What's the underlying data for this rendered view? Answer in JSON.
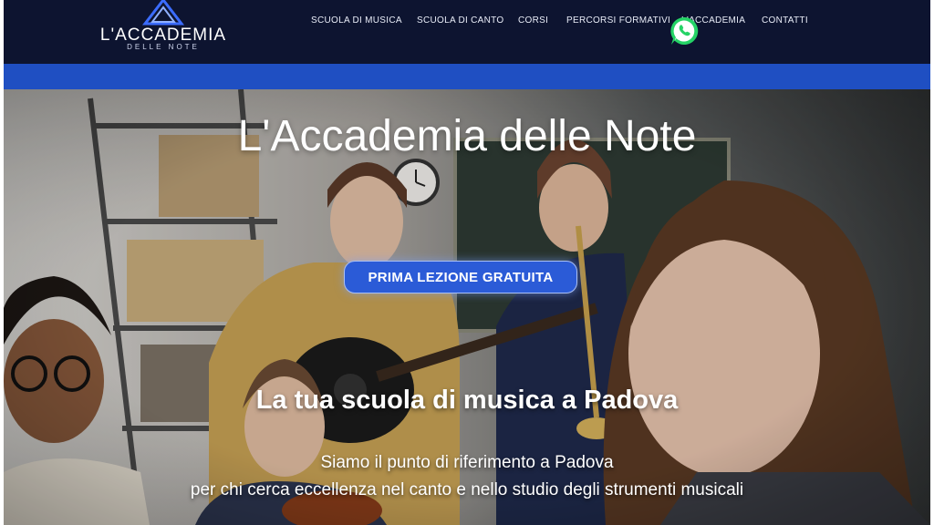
{
  "brand": {
    "name": "L'ACCADEMIA",
    "tagline": "DELLE NOTE"
  },
  "nav": {
    "items": [
      {
        "label": "SCUOLA DI MUSICA"
      },
      {
        "label": "SCUOLA DI CANTO"
      },
      {
        "label": "CORSI"
      },
      {
        "label": "PERCORSI FORMATIVI"
      },
      {
        "label": "L'ACCADEMIA"
      },
      {
        "label": "CONTATTI"
      }
    ]
  },
  "whatsapp": {
    "icon": "whatsapp-icon",
    "color": "#25d366"
  },
  "hero": {
    "title": "L'Accademia delle Note",
    "cta_label": "PRIMA LEZIONE GRATUITA",
    "subtitle": "La tua scuola di musica a Padova",
    "description_lines": [
      "Siamo il punto di riferimento a Padova",
      "per chi cerca eccellenza nel canto e nello studio degli strumenti musicali"
    ]
  },
  "colors": {
    "header_bg": "#0d1430",
    "accent_band": "#1f4fc2",
    "cta_bg": "#2b5bd7"
  }
}
